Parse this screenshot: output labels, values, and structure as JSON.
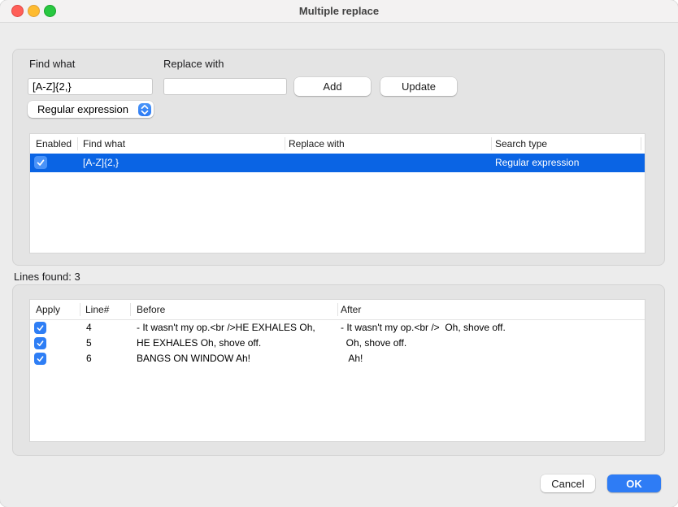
{
  "window": {
    "title": "Multiple replace"
  },
  "colors": {
    "accent_blue": "#2e7cf5",
    "selection_blue": "#0a64e4",
    "checkbox_blue": "#2e7ef5",
    "traffic_red": "#ff5f58",
    "traffic_yellow": "#febb2f",
    "traffic_green": "#28c841"
  },
  "form": {
    "find_label": "Find what",
    "find_value": "[A-Z]{2,}",
    "replace_label": "Replace with",
    "replace_value": "",
    "add_label": "Add",
    "update_label": "Update",
    "search_type_dropdown_value": "Regular expression"
  },
  "rules_table": {
    "headers": [
      "Enabled",
      "Find what",
      "Replace with",
      "Search type"
    ],
    "rows": [
      {
        "enabled": true,
        "find": "[A-Z]{2,}",
        "replace": "",
        "search_type": "Regular expression",
        "selected": true
      }
    ]
  },
  "lines_found_label": "Lines found: 3",
  "results_table": {
    "headers": [
      "Apply",
      "Line#",
      "Before",
      "After"
    ],
    "rows": [
      {
        "apply": true,
        "line": "4",
        "before": "- It wasn't my op.<br />HE EXHALES Oh,",
        "after": "- It wasn't my op.<br />  Oh, shove off."
      },
      {
        "apply": true,
        "line": "5",
        "before": "HE EXHALES Oh, shove off.",
        "after": "  Oh, shove off."
      },
      {
        "apply": true,
        "line": "6",
        "before": "BANGS ON WINDOW Ah!",
        "after": "   Ah!"
      }
    ]
  },
  "footer": {
    "cancel_label": "Cancel",
    "ok_label": "OK"
  }
}
